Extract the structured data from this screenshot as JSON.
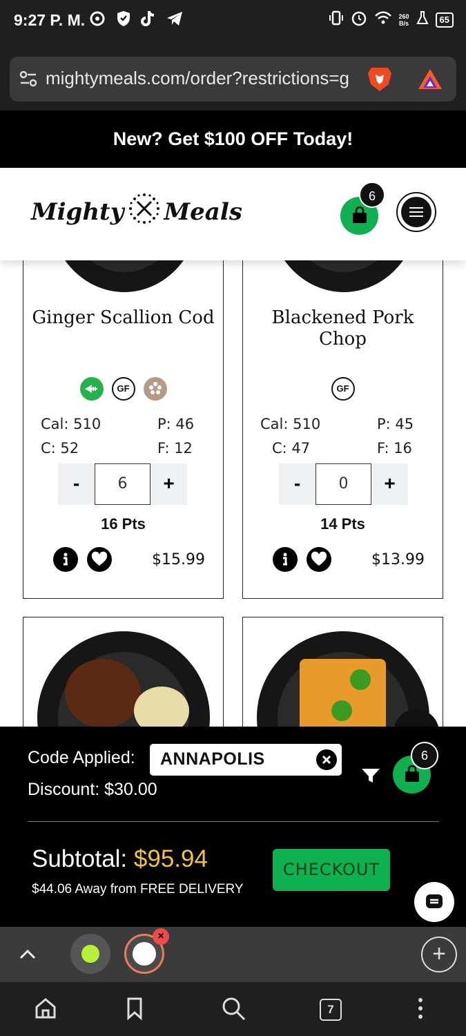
{
  "status_bar": {
    "time": "9:27 P. M.",
    "net_speed_value": "260",
    "net_speed_unit": "B/s",
    "battery": "65"
  },
  "browser": {
    "url": "mightymeals.com/order?restrictions=g",
    "tab_count": "7"
  },
  "promo": {
    "text": "New? Get $100 OFF Today!"
  },
  "header": {
    "logo_left": "Mighty",
    "logo_right": "Meals",
    "cart_count": "6"
  },
  "meals": [
    {
      "name": "Ginger Scallion Cod",
      "cal": "Cal: 510",
      "protein": "P: 46",
      "carbs": "C: 52",
      "fat": "F: 12",
      "qty": "6",
      "minus": "-",
      "plus": "+",
      "points": "16 Pts",
      "price": "$15.99",
      "badges": [
        "low-carb-icon",
        "gluten-free-icon",
        "dairy-free-icon"
      ]
    },
    {
      "name": "Blackened Pork Chop",
      "cal": "Cal: 510",
      "protein": "P: 45",
      "carbs": "C: 47",
      "fat": "F: 16",
      "qty": "0",
      "minus": "-",
      "plus": "+",
      "points": "14 Pts",
      "price": "$13.99",
      "badges": [
        "gluten-free-icon"
      ]
    }
  ],
  "badge_text": {
    "gf": "GF"
  },
  "code_panel": {
    "code_label": "Code Applied:",
    "code_value": "ANNAPOLIS",
    "discount_label": "Discount: $30.00",
    "cart_count": "6",
    "subtotal_label": "Subtotal:",
    "subtotal_amount": "$95.94",
    "free_delivery_text": "$44.06 Away from FREE DELIVERY",
    "checkout_label": "CHECKOUT"
  },
  "colors": {
    "brand_green": "#0fb04f",
    "subtotal_yellow": "#f3c33b",
    "tab_accent": "#ef7c58"
  }
}
